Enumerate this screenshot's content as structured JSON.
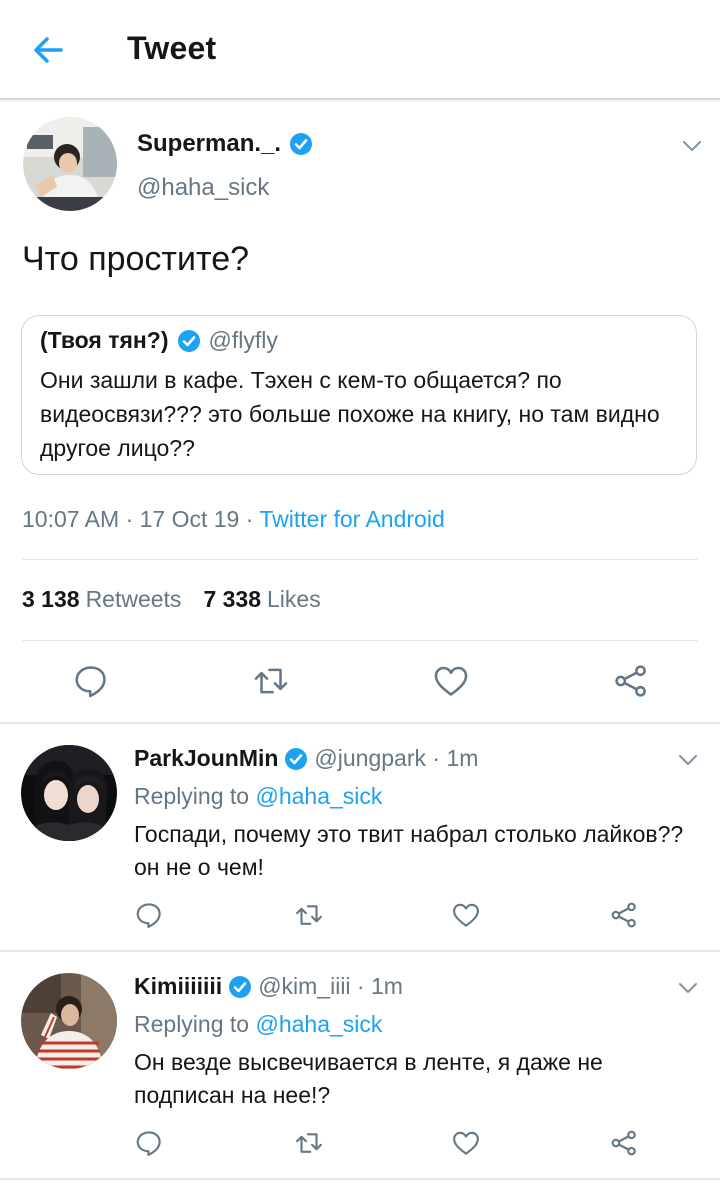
{
  "header": {
    "title": "Tweet"
  },
  "main_tweet": {
    "name": "Superman._.",
    "handle": "@haha_sick",
    "text": "Что простите?",
    "quote": {
      "name": "(Твоя тян?)",
      "handle": "@flyfly",
      "text": "Они зашли в кафе. Тэхен с кем-то общается? по видеосвязи??? это больше похоже на книгу, но там видно другое лицо??"
    },
    "time": "10:07 AM · 17 Oct 19 · ",
    "source": "Twitter for Android",
    "retweets_count": "3 138",
    "retweets_label": "Retweets",
    "likes_count": "7 338",
    "likes_label": "Likes"
  },
  "replies": [
    {
      "name": "ParkJounMin",
      "handle": "@jungpark",
      "time": " · 1m",
      "replying_label": "Replying to",
      "replying_to": "@haha_sick",
      "text": "Госпади, почему это твит набрал столько лайков?? он не о чем!"
    },
    {
      "name": "Kimiiiiiii",
      "handle": "@kim_iiii",
      "time": " · 1m",
      "replying_label": "Replying to",
      "replying_to": "@haha_sick",
      "text": "Он везде высвечивается в ленте, я даже не подписан на нее!?"
    }
  ],
  "colors": {
    "accent": "#1da1f2",
    "secondary_text": "#657786",
    "divider": "#e1e8ed"
  },
  "icons": [
    "back-arrow-icon",
    "verified-badge-icon",
    "chevron-down-icon",
    "reply-icon",
    "retweet-icon",
    "like-icon",
    "share-icon"
  ]
}
